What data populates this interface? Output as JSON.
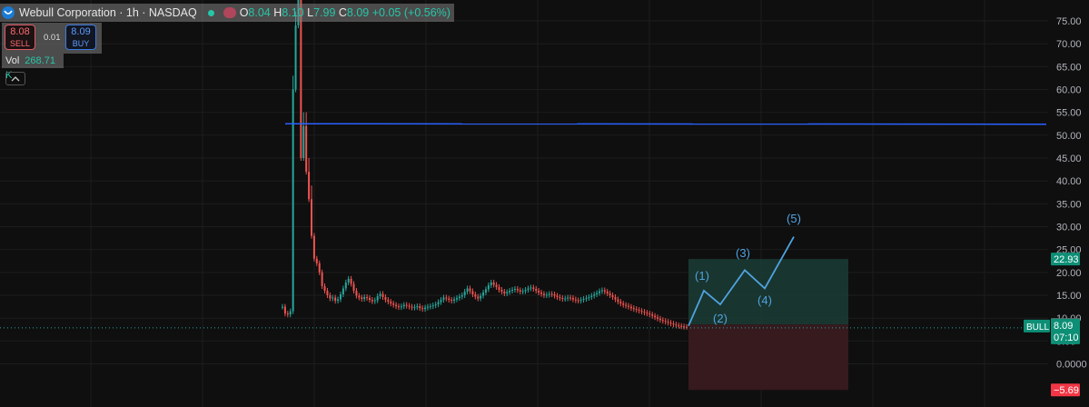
{
  "header": {
    "title": "Webull Corporation · 1h · NASDAQ",
    "ohlc": {
      "o_label": "O",
      "o": "8.04",
      "h_label": "H",
      "h": "8.10",
      "l_label": "L",
      "l": "7.99",
      "c_label": "C",
      "c": "8.09",
      "change": "+0.05 (+0.56%)"
    }
  },
  "trade": {
    "sell_price": "8.08",
    "sell_label": "SELL",
    "spread": "0.01",
    "buy_price": "8.09",
    "buy_label": "BUY"
  },
  "volume": {
    "label": "Vol",
    "value": "268.71 K"
  },
  "colors": {
    "up": "#26a69a",
    "down": "#ef5350",
    "resistance": "#2962ff",
    "wave": "#4fa3e0",
    "target_zone": "#1b3a33",
    "stop_zone": "#3b1c20",
    "target_badge": "#0d8f76",
    "stop_badge": "#f23645"
  },
  "chart_data": {
    "type": "line",
    "title": "Webull Corporation · 1h · NASDAQ",
    "ylim": [
      -9,
      80
    ],
    "y_ticks": [
      "75.00",
      "70.00",
      "65.00",
      "60.00",
      "55.00",
      "50.00",
      "45.00",
      "40.00",
      "35.00",
      "30.00",
      "25.00",
      "20.00",
      "15.00",
      "10.00",
      "5.00",
      "0.0000"
    ],
    "price_series": {
      "name": "",
      "values": [
        12.5,
        11,
        10.8,
        11.5,
        60,
        74,
        80,
        45,
        52,
        42,
        36,
        28,
        23,
        22,
        20,
        17,
        16,
        15,
        14.3,
        14.5,
        13.8,
        14.1,
        15.2,
        16.5,
        17.8,
        18.6,
        17.5,
        16,
        14.9,
        14.5,
        14.2,
        14.6,
        14.4,
        14,
        13.7,
        13.9,
        14.8,
        15.3,
        14.6,
        14,
        13.6,
        13.2,
        12.9,
        12.6,
        12.4,
        12.6,
        12.9,
        12.7,
        12.5,
        12.3,
        12.4,
        12.6,
        12.2,
        12,
        12.3,
        12.5,
        12.6,
        12.8,
        13,
        13.5,
        14,
        14.5,
        14.3,
        14,
        13.8,
        14.1,
        14.4,
        14.7,
        15,
        15.8,
        16.5,
        15.9,
        15.2,
        14.7,
        14.3,
        14.9,
        15.6,
        16.3,
        17.2,
        17.8,
        17.3,
        16.8,
        16.2,
        15.8,
        15.4,
        15.7,
        16,
        16.2,
        16.4,
        16.1,
        15.8,
        15.9,
        16.2,
        16.5,
        16.7,
        16.4,
        16,
        15.6,
        15.3,
        15,
        15.1,
        15.3,
        15.2,
        14.9,
        14.6,
        14.4,
        14.2,
        14.3,
        14.5,
        14.4,
        14.1,
        13.9,
        13.8,
        14,
        14.2,
        14.4,
        14.6,
        14.9,
        15.2,
        15.5,
        15.9,
        16.1,
        15.8,
        15.4,
        15,
        14.6,
        14.1,
        13.6,
        13.2,
        12.9,
        12.7,
        12.5,
        12.2,
        12,
        11.8,
        11.6,
        11.4,
        11.2,
        11,
        10.8,
        10.5,
        10.2,
        9.9,
        9.6,
        9.4,
        9.2,
        9,
        8.8,
        8.6,
        8.4,
        8.3,
        8.2,
        8.1,
        8.09
      ]
    },
    "resistance_level": 52.5,
    "current_price": "8.09",
    "current_price_label": "BULL",
    "countdown": "07:10",
    "entry_price": "8.62",
    "target_price": "22.93",
    "stop_price": "−5.69",
    "elliott_wave": {
      "labels": [
        "(1)",
        "(2)",
        "(3)",
        "(4)",
        "(5)"
      ],
      "points": [
        [
          0,
          8.3
        ],
        [
          1,
          16
        ],
        [
          2,
          13
        ],
        [
          3,
          20.5
        ],
        [
          4,
          16.5
        ],
        [
          5,
          27.8
        ]
      ]
    }
  }
}
